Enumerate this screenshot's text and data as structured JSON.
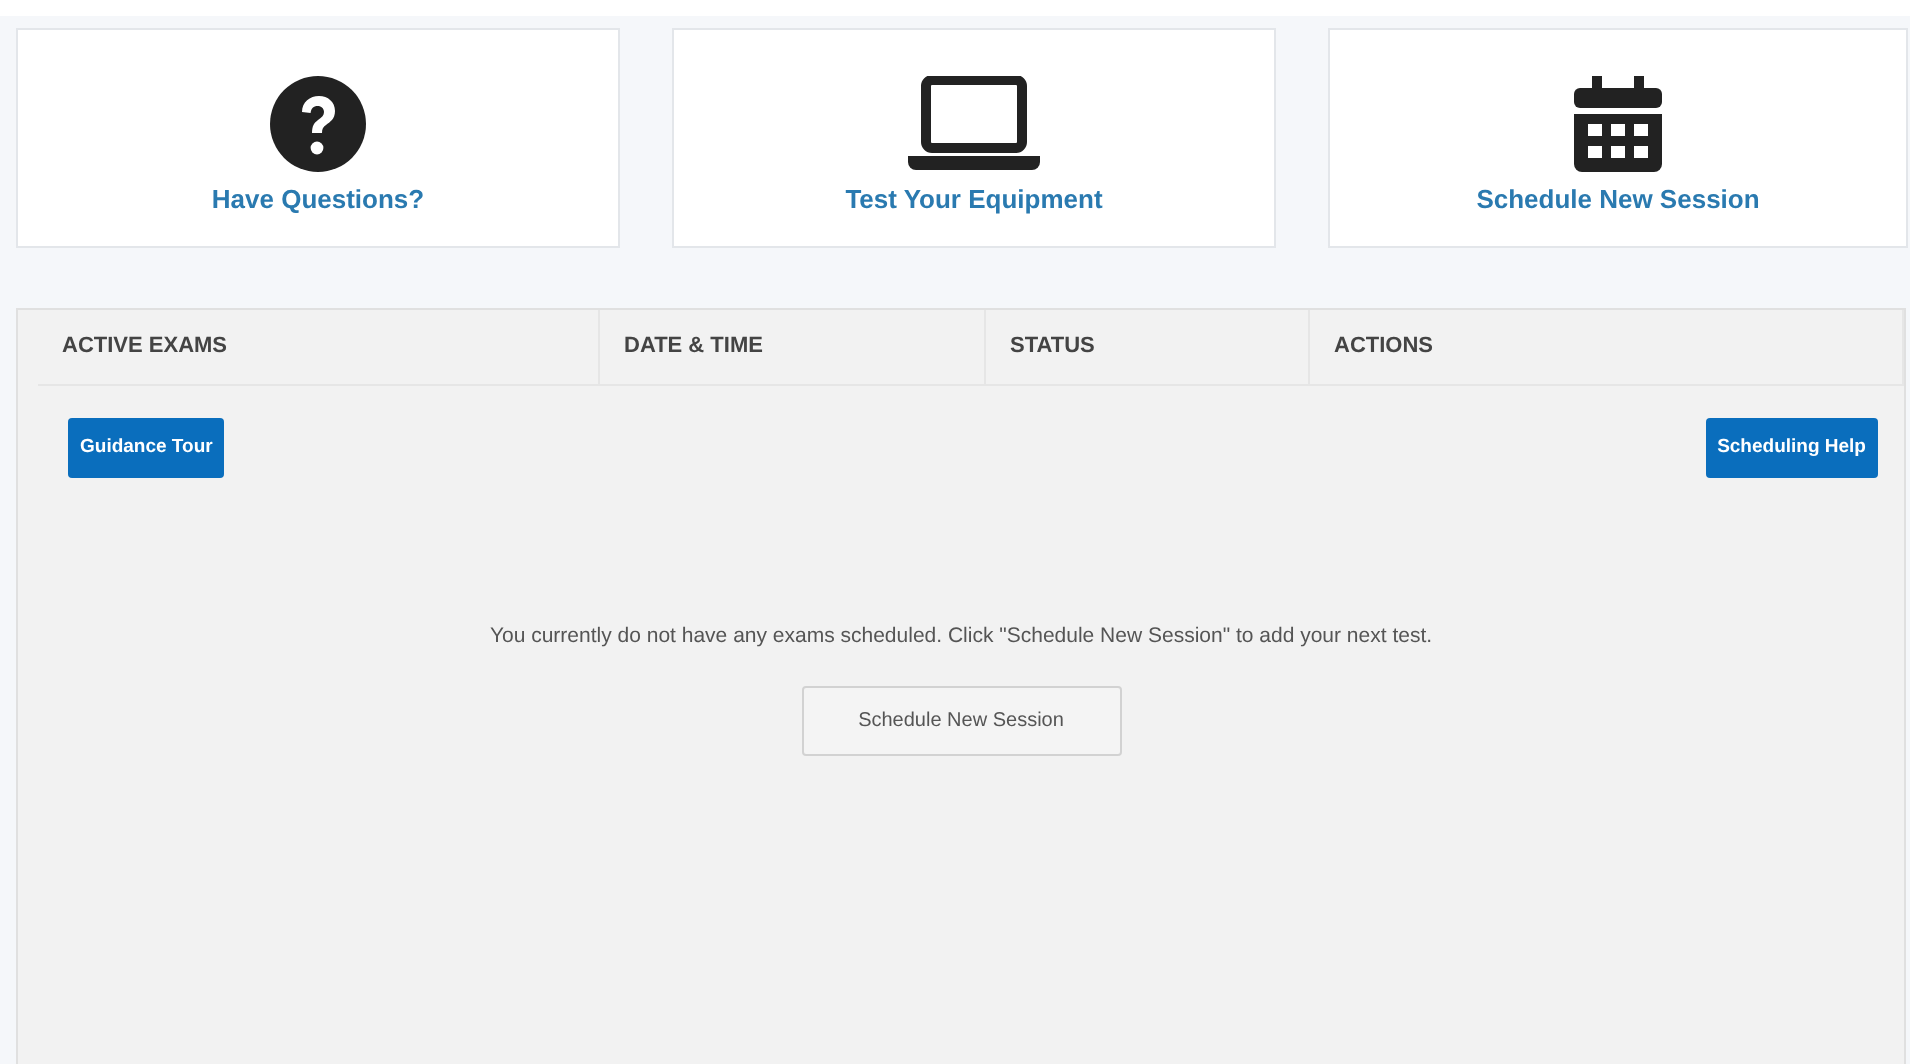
{
  "cards": [
    {
      "kind": "question",
      "label": "Have Questions?"
    },
    {
      "kind": "laptop",
      "label": "Test Your Equipment"
    },
    {
      "kind": "calendar",
      "label": "Schedule New Session"
    }
  ],
  "table": {
    "columns": [
      "ACTIVE EXAMS",
      "DATE & TIME",
      "STATUS",
      "ACTIONS"
    ]
  },
  "toolbar": {
    "left_button": "Guidance Tour",
    "right_button": "Scheduling Help"
  },
  "empty_message": "You currently do not have any exams scheduled. Click \"Schedule New Session\" to add your next test.",
  "empty_button": "Schedule New Session"
}
